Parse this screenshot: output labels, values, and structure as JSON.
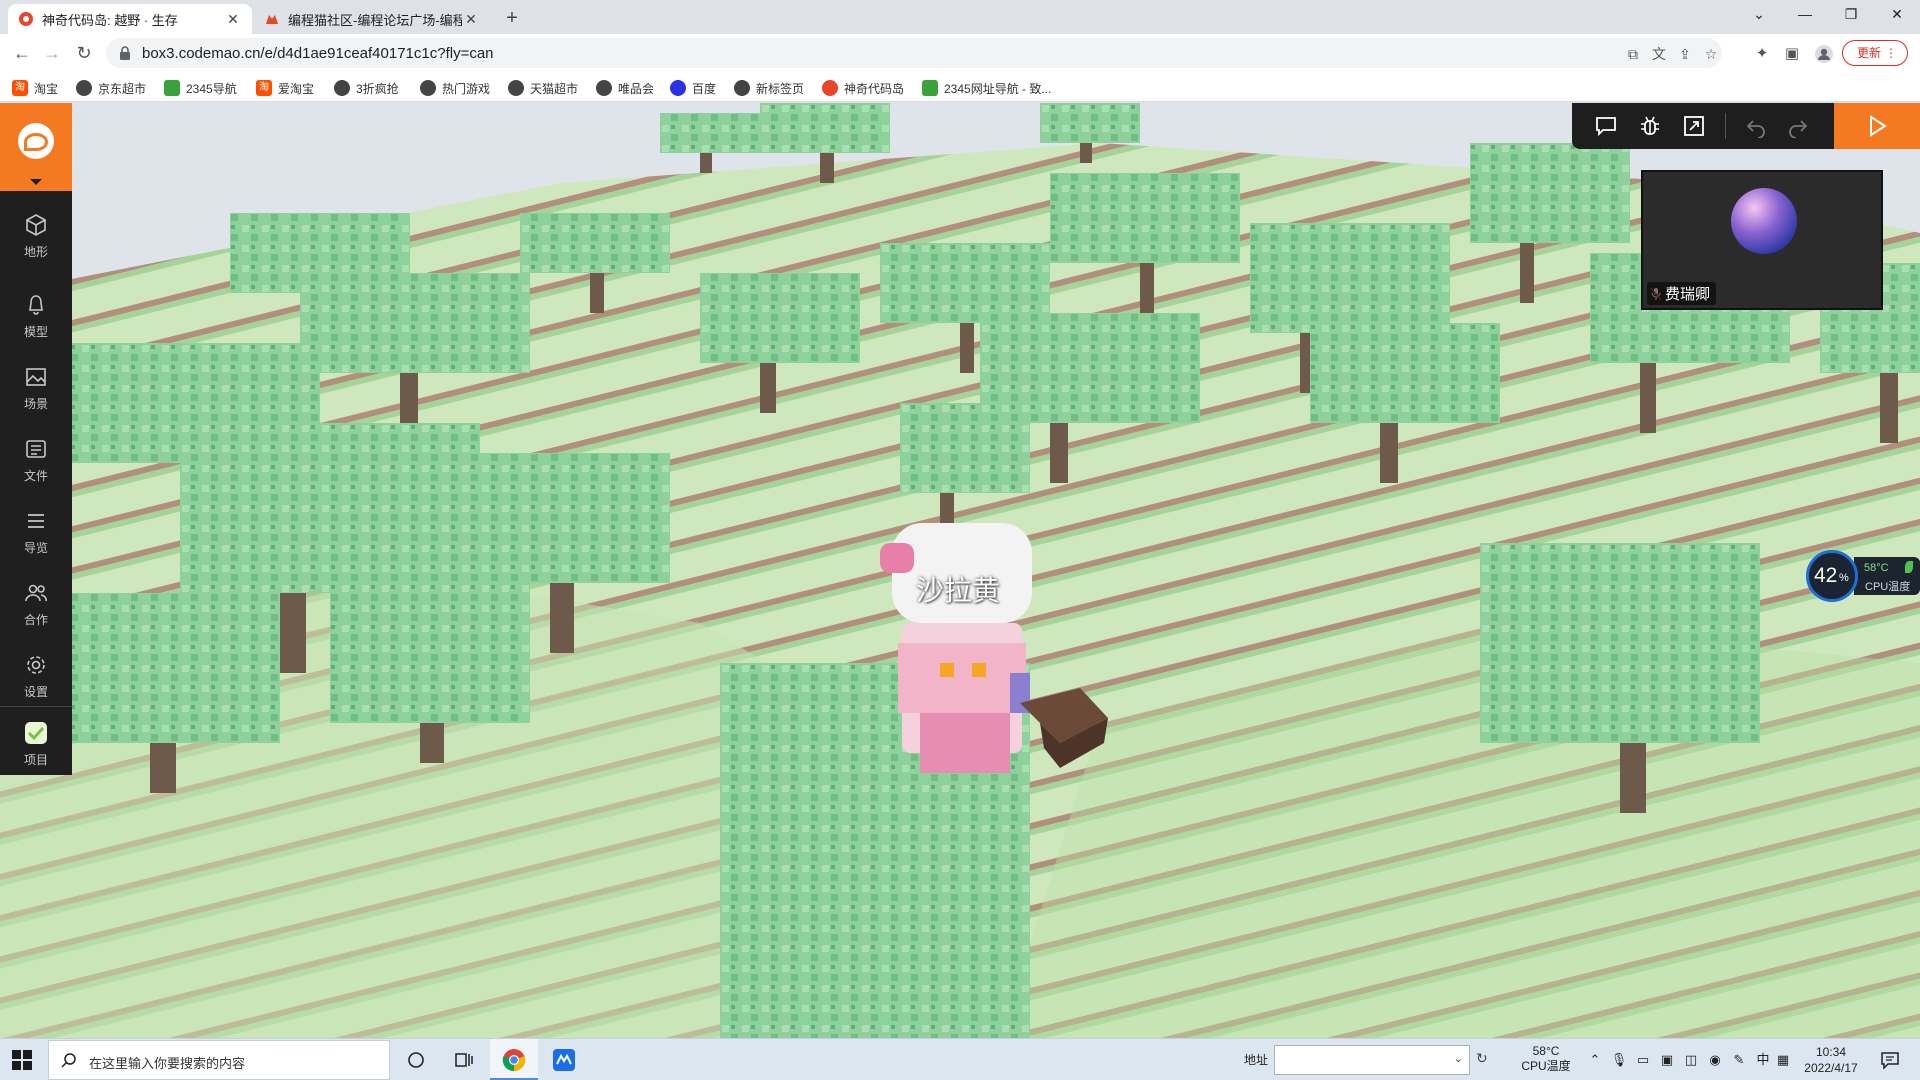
{
  "browser": {
    "tabs": [
      {
        "title": "神奇代码岛: 越野 · 生存",
        "active": true
      },
      {
        "title": "编程猫社区-编程论坛广场-编程学",
        "active": false
      }
    ],
    "url": "box3.codemao.cn/e/d4d1ae91ceaf40171c1c?fly=can",
    "update_label": "更新",
    "bookmarks": [
      {
        "label": "淘宝",
        "color": "#ff5000",
        "glyph": "淘"
      },
      {
        "label": "京东超市",
        "color": "#444444",
        "glyph": ""
      },
      {
        "label": "2345导航",
        "color": "#3aa23a",
        "glyph": ""
      },
      {
        "label": "爱淘宝",
        "color": "#ff5000",
        "glyph": "淘"
      },
      {
        "label": "3折疯抢",
        "color": "#444444",
        "glyph": ""
      },
      {
        "label": "热门游戏",
        "color": "#444444",
        "glyph": ""
      },
      {
        "label": "天猫超市",
        "color": "#444444",
        "glyph": ""
      },
      {
        "label": "唯品会",
        "color": "#444444",
        "glyph": ""
      },
      {
        "label": "百度",
        "color": "#2932e1",
        "glyph": ""
      },
      {
        "label": "新标签页",
        "color": "#444444",
        "glyph": ""
      },
      {
        "label": "神奇代码岛",
        "color": "#e8452c",
        "glyph": ""
      },
      {
        "label": "2345网址导航 - 致...",
        "color": "#3aa23a",
        "glyph": ""
      }
    ]
  },
  "editor": {
    "left_rail": [
      {
        "key": "terrain",
        "label": "地形",
        "icon": "cube-icon"
      },
      {
        "key": "model",
        "label": "模型",
        "icon": "bell-icon"
      },
      {
        "key": "scene",
        "label": "场景",
        "icon": "image-icon"
      },
      {
        "key": "file",
        "label": "文件",
        "icon": "file-icon"
      },
      {
        "key": "navigator",
        "label": "导览",
        "icon": "list-icon"
      },
      {
        "key": "collab",
        "label": "合作",
        "icon": "users-icon"
      },
      {
        "key": "settings",
        "label": "设置",
        "icon": "gear-icon"
      },
      {
        "key": "project",
        "label": "项目",
        "icon": "project-icon"
      }
    ],
    "video_user": "费瑞卿",
    "character_name": "沙拉黄",
    "cpu": {
      "percent": "42",
      "unit": "%",
      "temp": "58°C",
      "label": "CPU温度"
    }
  },
  "taskbar": {
    "search_placeholder": "在这里输入你要搜索的内容",
    "address_label": "地址",
    "cpu_temp": "58°C",
    "cpu_label": "CPU温度",
    "ime": "中",
    "time": "10:34",
    "date": "2022/4/17"
  },
  "colors": {
    "accent": "#f47920",
    "grass_light": "#cbe5b8",
    "grass_dark": "#7fb583",
    "leaf": "#8fd19c",
    "trunk": "#6e5a4b"
  }
}
